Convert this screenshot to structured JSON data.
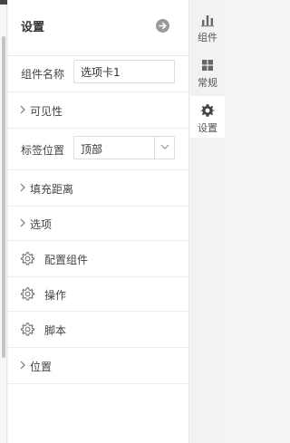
{
  "panel": {
    "title": "设置",
    "collapse_icon": "arrow-right-circle-icon"
  },
  "fields": {
    "component_name": {
      "label": "组件名称",
      "value": "选项卡1"
    },
    "tab_position": {
      "label": "标签位置",
      "value": "顶部"
    }
  },
  "sections": {
    "visibility": "可见性",
    "padding": "填充距离",
    "options": "选项",
    "configure_component": "配置组件",
    "actions": "操作",
    "script": "脚本",
    "position": "位置"
  },
  "tabs": [
    {
      "label": "组件",
      "icon": "bar-chart-icon",
      "active": false
    },
    {
      "label": "常规",
      "icon": "grid-icon",
      "active": false
    },
    {
      "label": "设置",
      "icon": "gear-icon",
      "active": true
    }
  ],
  "colors": {
    "panel_bg": "#ffffff",
    "tab_strip_bg": "#f2f2f2",
    "border": "#e8e8e8",
    "icon_gray": "#9a9a9a"
  }
}
